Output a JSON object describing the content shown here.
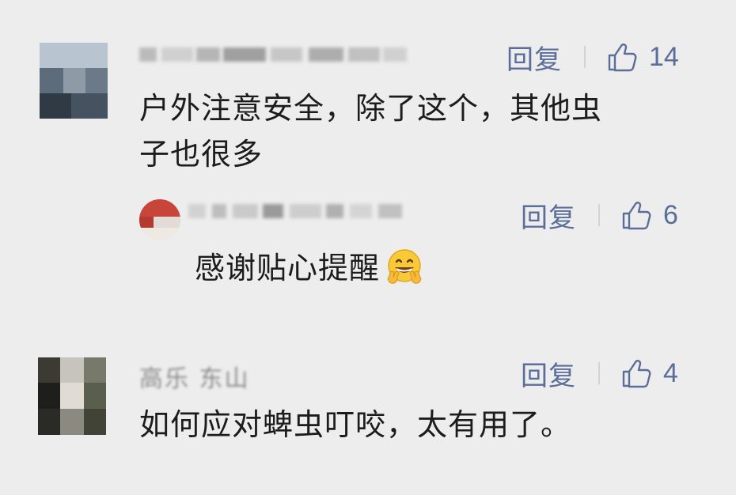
{
  "comments": [
    {
      "reply_label": "回复",
      "like_count": "14",
      "text_line1": "户外注意安全，除了这个，其他虫",
      "text_line2": "子也很多"
    },
    {
      "reply_label": "回复",
      "like_count": "6",
      "text": "感谢贴心提醒",
      "emoji": "grinning-peace-emoji"
    },
    {
      "name_visible": "高乐  东山",
      "reply_label": "回复",
      "like_count": "4",
      "text": "如何应对蜱虫叮咬，太有用了。"
    }
  ],
  "icons": {
    "like": "thumbs-up-outline-icon"
  },
  "colors": {
    "background": "#ededed",
    "action": "#5b6e99",
    "text": "#1c1c1c"
  }
}
